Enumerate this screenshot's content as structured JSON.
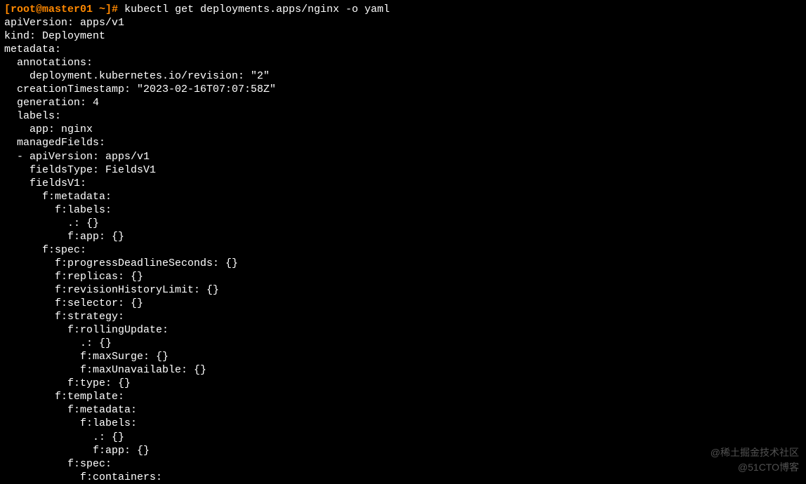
{
  "prompt": {
    "user_host": "[root@master01 ~]",
    "symbol": "#",
    "command": "kubectl get deployments.apps/nginx -o yaml"
  },
  "output_lines": [
    "apiVersion: apps/v1",
    "kind: Deployment",
    "metadata:",
    "  annotations:",
    "    deployment.kubernetes.io/revision: \"2\"",
    "  creationTimestamp: \"2023-02-16T07:07:58Z\"",
    "  generation: 4",
    "  labels:",
    "    app: nginx",
    "  managedFields:",
    "  - apiVersion: apps/v1",
    "    fieldsType: FieldsV1",
    "    fieldsV1:",
    "      f:metadata:",
    "        f:labels:",
    "          .: {}",
    "          f:app: {}",
    "      f:spec:",
    "        f:progressDeadlineSeconds: {}",
    "        f:replicas: {}",
    "        f:revisionHistoryLimit: {}",
    "        f:selector: {}",
    "        f:strategy:",
    "          f:rollingUpdate:",
    "            .: {}",
    "            f:maxSurge: {}",
    "            f:maxUnavailable: {}",
    "          f:type: {}",
    "        f:template:",
    "          f:metadata:",
    "            f:labels:",
    "              .: {}",
    "              f:app: {}",
    "          f:spec:",
    "            f:containers:"
  ],
  "watermark": {
    "line1": "@稀土掘金技术社区",
    "line2": "@51CTO博客"
  }
}
